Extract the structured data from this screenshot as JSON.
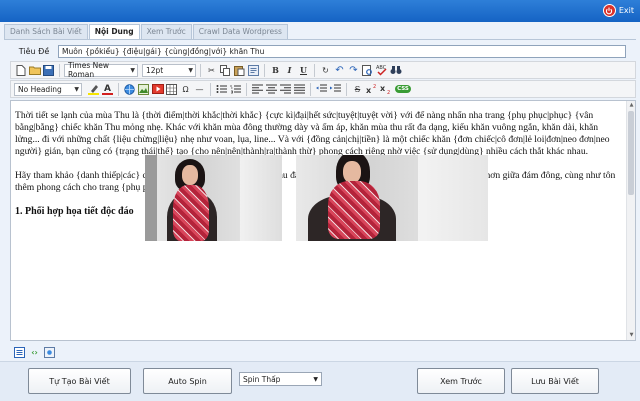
{
  "exit_label": "Exit",
  "tabs": [
    {
      "label": "Danh Sách Bài Viết",
      "active": false
    },
    {
      "label": "Nội Dung",
      "active": true
    },
    {
      "label": "Xem Trước",
      "active": false
    },
    {
      "label": "Crawl Data Wordpress",
      "active": false
    }
  ],
  "title": {
    "label": "Tiêu Đề",
    "value": "Muôn {pồkiểu} {điệu|gái} {cùng|đồng|với} khăn Thu"
  },
  "toolbar": {
    "font_name": "Times New Roman",
    "font_size": "12pt",
    "heading": "No Heading",
    "bold": "B",
    "italic": "I",
    "underline": "U",
    "spin_label": "S",
    "css_label": "CSS"
  },
  "editor": {
    "paragraph1": "Thời tiết se lạnh của mùa Thu là {thời điểm|thời khắc|thời khắc} {cực kì|đại|hết sức|tuyệt|tuyệt vời} với để nàng nhẩn nha trang {phụ phục|phục} {vân bằng|bằng} chiếc khăn Thu mỏng nhẹ. Khác với khăn mùa đông thường dày và ấm áp, khăn mùa thu rất đa dạng, kiểu khăn vuông ngắn, khăn dài, khăn lửng... đi với những chất {liệu chừng|liệu} nhẹ như voan, lụa, line... Và với {đồng cản|chị|tiền} là một chiếc khăn {đơn chiếc|cô đơn|lẻ loi|đơn|neo đơn|neo người} gián, bạn cũng có {trạng thái|thể} tạo {cho nên|nên|thành|ra|thành thừ} phong cách riêng nhờ việc {sử dụng|dùng} nhiều cách thắt khác nhau.",
    "paragraph2": "Hãy tham khảo {danh thiếp|các} cách biến tấu thắt khăn khác nhau sau đây để tạo cho mình những style {nổi bật|nổi trội} hơn giữa đám đông, cùng như tôn thêm phong cách cho trang {phụ phục|phục} nhé!",
    "heading1": "1. Phối hợp họa tiết độc đáo"
  },
  "buttons": {
    "create": "Tự Tạo Bài Viết",
    "auto_spin": "Auto Spin",
    "spin_level": "Spin Thấp",
    "preview": "Xem Trước",
    "save": "Lưu Bài Viết"
  },
  "colors": {
    "titlebar": "#1f6fcf",
    "exit": "#d9312b",
    "scarf": "#c0324a"
  }
}
